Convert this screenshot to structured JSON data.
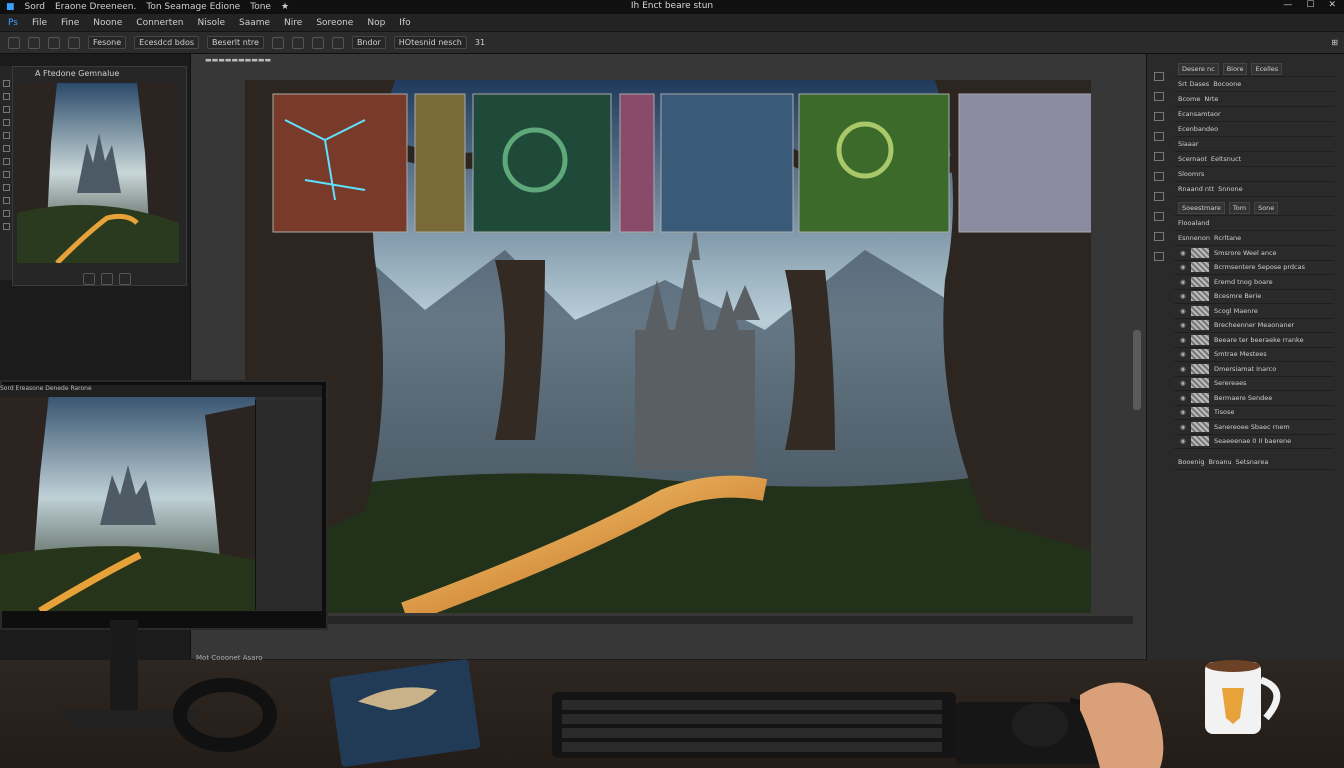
{
  "titlebar": {
    "menu": [
      "Sord",
      "Eraone Dreeneen.",
      "Ton Seamage Edione",
      "Tone",
      "★"
    ],
    "doc_title": "Ih Enct beare stun"
  },
  "menubar": [
    "File",
    "Fine",
    "Noone",
    "Connerten",
    "Nisole",
    "Saame",
    "Nire",
    "Soreone",
    "Nop",
    "Ifo"
  ],
  "options": {
    "field1": "Fesone",
    "field2": "Ecesdcd bdos",
    "field3": "Beserlt ntre",
    "brush": "Bndor",
    "mode": "HOtesnid nesch",
    "count": "31"
  },
  "navigator": {
    "title": "A Ftedone Gemnalue"
  },
  "right_panel": {
    "tabs_row1": [
      "Desere nc",
      "Biore",
      "Ecelles"
    ],
    "rows": [
      "Srt Dases",
      "Bocoone",
      "Ecansamtaor",
      "Siaaar",
      "Scernaot",
      "Rnaand ntt"
    ],
    "row_labels": [
      "Bcome",
      "Nrte",
      "Ecenbandeo",
      "Eeltsnuct",
      "Sloomrs",
      "Snnone",
      "Esnnenon",
      "Rcrltane",
      "Booenig",
      "Broanu",
      "Setsnarea"
    ],
    "layers_tabs": [
      "Soeestmare",
      "Tom",
      "Sone"
    ],
    "layer_opacity": "Flooaland",
    "layers": [
      "Smsrore Weel ance",
      "Bcrmsentere Sepose prdcas",
      "Eremd tnog boare",
      "Bcesmre Berie",
      "Scogl Maenre",
      "Brecheenner Meaonaner",
      "Beeare ter beeraeke rranke",
      "Smtrae Mestees",
      "Dmersiamat Inarco",
      "Serereaes",
      "Bermaere Sendee",
      "Tisose",
      "Sanereoee Sbaec rnem",
      "Seaeeenae 0 II baerene"
    ]
  },
  "status": "Mot Cooonet Asaro",
  "monitor2": {
    "menu": "Sord Ereasone Denede Rarone"
  },
  "accent": "#e8a23a"
}
